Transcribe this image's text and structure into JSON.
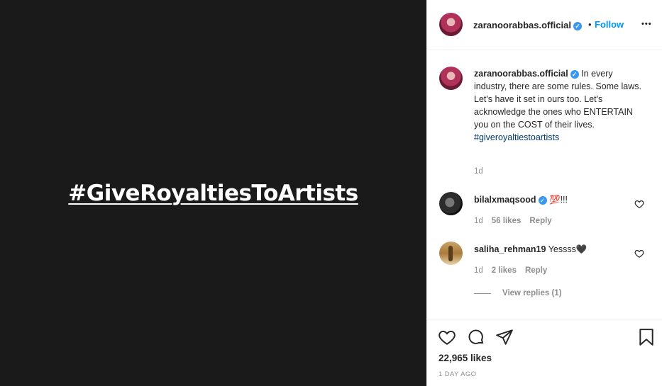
{
  "post": {
    "image_text": "#GiveRoyaltiesToArtists"
  },
  "header": {
    "username": "zaranoorabbas.official",
    "separator": "•",
    "follow_label": "Follow",
    "more_label": "•••"
  },
  "caption": {
    "username": "zaranoorabbas.official",
    "text": "In every industry, there are some rules. Some laws. Let's have it set in ours too. Let's acknowledge the ones who ENTERTAIN you on the COST of their lives.",
    "hashtag": "#giveroyaltiestoartists",
    "age": "1d"
  },
  "comments": [
    {
      "username": "bilalxmaqsood",
      "text": "💯!!!",
      "age": "1d",
      "likes": "56 likes",
      "reply_label": "Reply"
    },
    {
      "username": "saliha_rehman19",
      "text": "Yessss🖤",
      "age": "1d",
      "likes": "2 likes",
      "reply_label": "Reply"
    }
  ],
  "view_replies_label": "View replies (1)",
  "footer": {
    "likes": "22,965 likes",
    "time_ago": "1 DAY AGO"
  },
  "icons": {
    "verified": "verified-badge-icon",
    "like": "heart-icon",
    "comment": "comment-bubble-icon",
    "share": "paper-plane-icon",
    "save": "bookmark-icon"
  },
  "colors": {
    "link_blue": "#0095f6",
    "hashtag": "#00376b",
    "muted": "#8e8e8e",
    "verified": "#3897f0",
    "image_bg": "#1a1a1a"
  }
}
